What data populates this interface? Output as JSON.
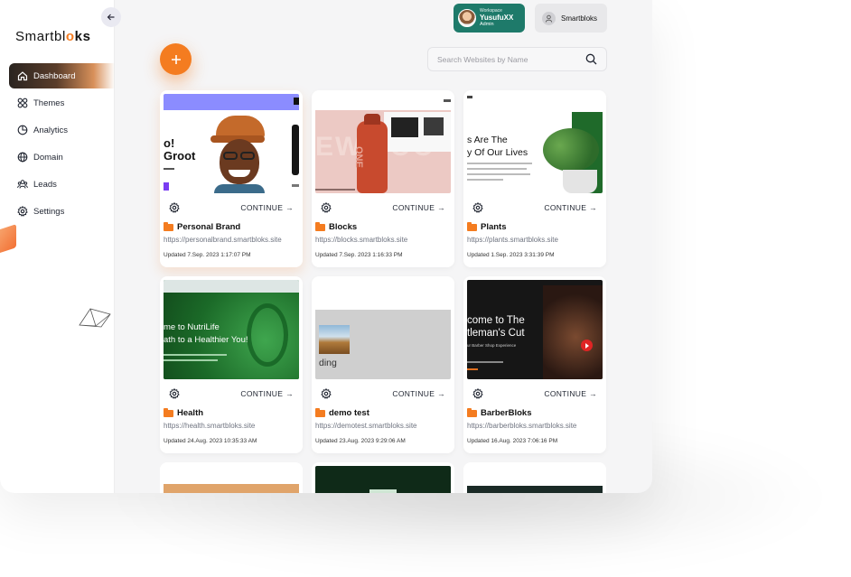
{
  "app": {
    "logo_text": "Smartbl",
    "logo_accent": "o",
    "logo_tail": "ks"
  },
  "sidebar": {
    "items": [
      {
        "label": "Dashboard",
        "icon": "home-icon"
      },
      {
        "label": "Themes",
        "icon": "grid-icon"
      },
      {
        "label": "Analytics",
        "icon": "pie-chart-icon"
      },
      {
        "label": "Domain",
        "icon": "globe-icon"
      },
      {
        "label": "Leads",
        "icon": "users-icon"
      },
      {
        "label": "Settings",
        "icon": "gear-icon"
      }
    ]
  },
  "topbar": {
    "workspace_label": "Workspace",
    "workspace_user": "YusufuXX",
    "workspace_role": "Admin",
    "account_name": "Smartbloks"
  },
  "search": {
    "placeholder": "Search Websites by Name"
  },
  "colors": {
    "accent": "#f47c20",
    "workspace": "#1e7a6a"
  },
  "cards": [
    {
      "name": "Personal Brand",
      "url": "https://personalbrand.smartbloks.site",
      "updated": "Updated 7.Sep. 2023 1:17:07 PM",
      "action": "CONTINUE"
    },
    {
      "name": "Blocks",
      "url": "https://blocks.smartbloks.site",
      "updated": "Updated 7.Sep. 2023 1:16:33 PM",
      "action": "CONTINUE"
    },
    {
      "name": "Plants",
      "url": "https://plants.smartbloks.site",
      "updated": "Updated 1.Sep. 2023 3:31:39 PM",
      "action": "CONTINUE"
    },
    {
      "name": "Health",
      "url": "https://health.smartbloks.site",
      "updated": "Updated 24.Aug. 2023 10:35:33 AM",
      "action": "CONTINUE"
    },
    {
      "name": "demo test",
      "url": "https://demotest.smartbloks.site",
      "updated": "Updated 23.Aug. 2023 9:29:06 AM",
      "action": "CONTINUE"
    },
    {
      "name": "BarberBloks",
      "url": "https://barberbloks.smartbloks.site",
      "updated": "Updated 16.Aug. 2023 7:06:16 PM",
      "action": "CONTINUE"
    }
  ],
  "thumbs": {
    "personal": {
      "line1": "o!",
      "line2": "Groot"
    },
    "blocks": {
      "big": "EW TOO",
      "bottle": "ONE"
    },
    "plants": {
      "line1": "s Are The",
      "line2": "y Of Our Lives"
    },
    "health": {
      "line1": "me to NutriLife",
      "line2": "ath to a Healthier You!"
    },
    "demo": {
      "line1": "ding"
    },
    "barber": {
      "line1": "come to The",
      "line2": "tleman's Cut",
      "sub": "ur Barber Shop Experience"
    }
  }
}
